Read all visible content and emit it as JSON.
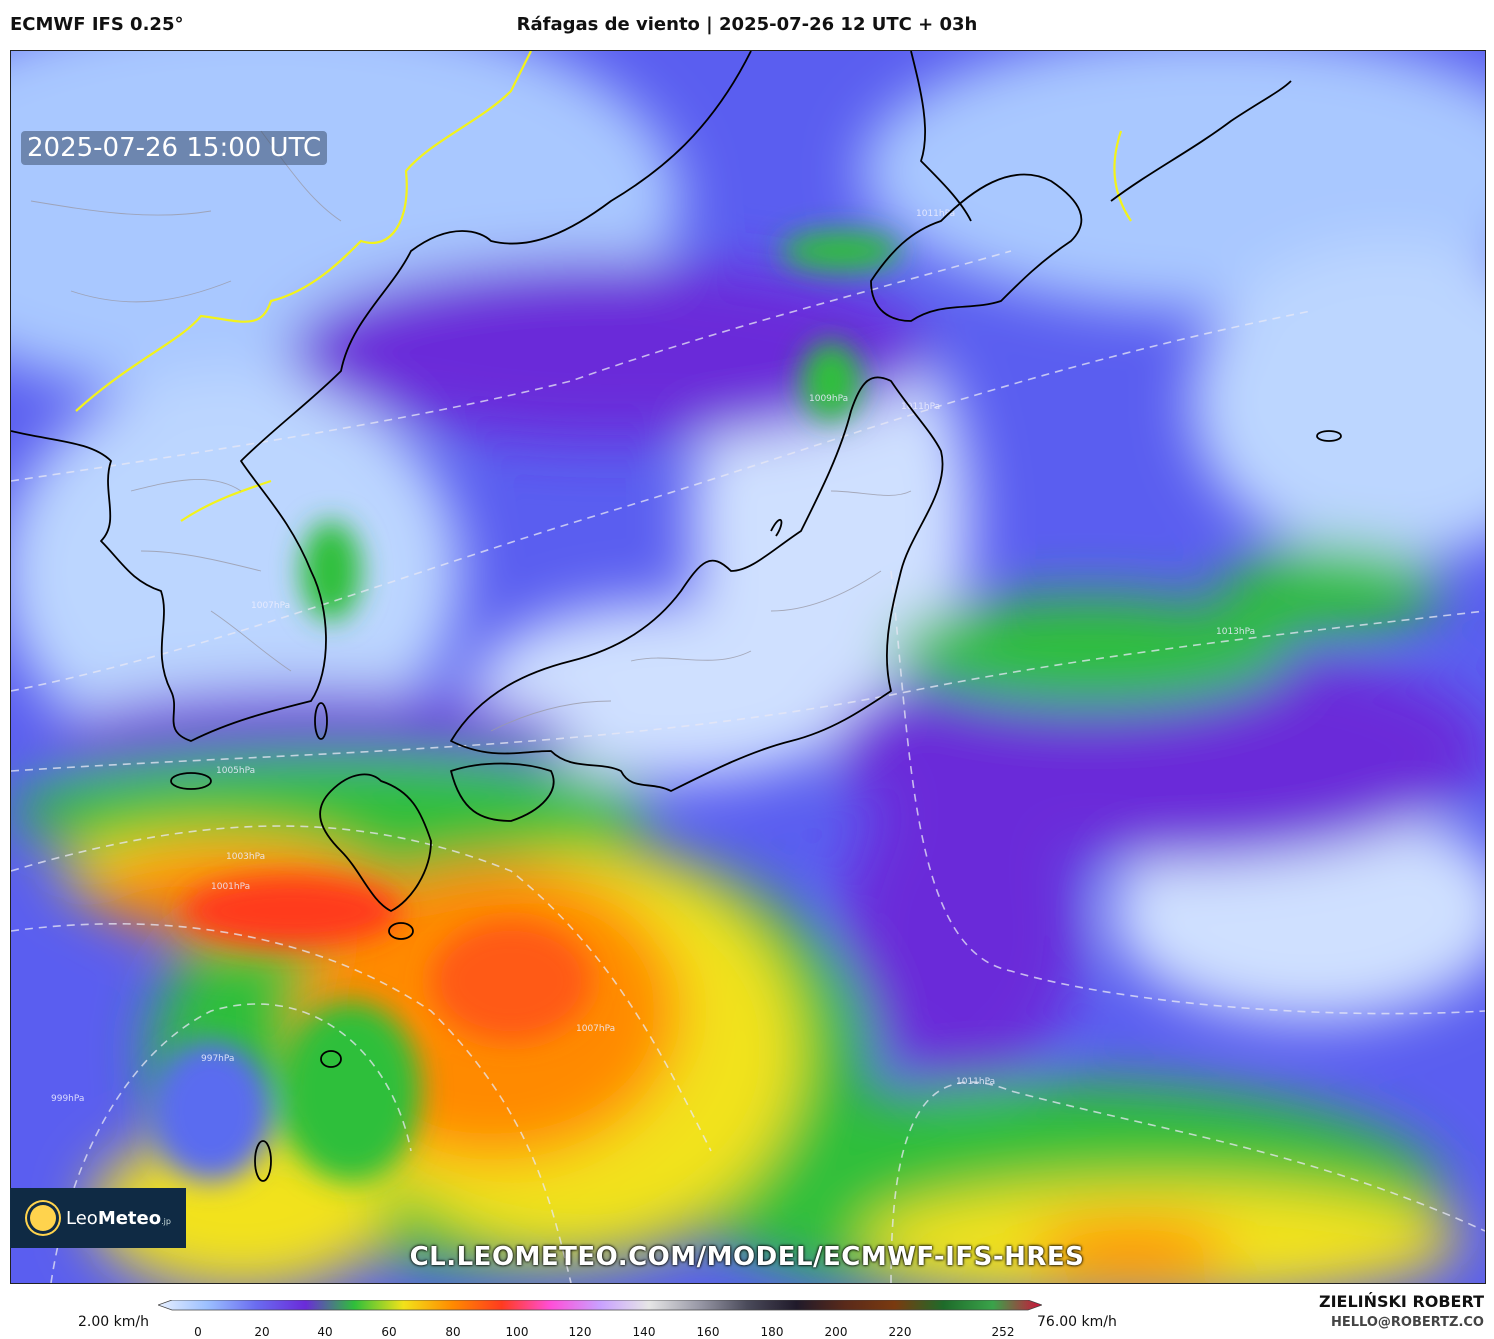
{
  "header": {
    "model": "ECMWF IFS 0.25°",
    "title": "Ráfagas de viento | 2025-07-26 12 UTC + 03h"
  },
  "map": {
    "valid_time": "2025-07-26 15:00 UTC",
    "isobar_labels": [
      "1013hPa",
      "1011hPa",
      "1011hPa",
      "1009hPa",
      "1007hPa",
      "1005hPa",
      "1003hPa",
      "1001hPa",
      "999hPa",
      "997hPa",
      "1007hPa",
      "1011hPa"
    ],
    "colors": {
      "low": "#cfe4ff",
      "light_blue": "#8fb4ff",
      "blue": "#5a6cf0",
      "purple": "#6b2bd9",
      "green": "#2fbf3a",
      "yellow": "#f2e21a",
      "orange": "#ff8a00",
      "red": "#ff3b1f",
      "coast": "#000000",
      "border": "#f3f31a"
    }
  },
  "branding": {
    "logo_text_main": "Leo",
    "logo_text_bold": "Meteo",
    "logo_text_suffix": ".jp",
    "url": "CL.LEOMETEO.COM/MODEL/ECMWF-IFS-HRES"
  },
  "colorbar": {
    "min_label": "2.00 km/h",
    "max_label": "76.00 km/h",
    "ticks": [
      "0",
      "20",
      "40",
      "60",
      "80",
      "100",
      "120",
      "140",
      "160",
      "180",
      "200",
      "220",
      "252"
    ],
    "stops": [
      "#e8f0ff",
      "#9cc0ff",
      "#6a6cf0",
      "#6a2bd9",
      "#2fbf3a",
      "#f2e21a",
      "#ff8a00",
      "#ff3b1f",
      "#ff4fd8",
      "#c9a0ff",
      "#e6e6e6",
      "#9a9aa8",
      "#4a4a5a",
      "#201a2a",
      "#5a2a1a",
      "#7a3a10",
      "#1e6b2a",
      "#3aa34a",
      "#d0103a"
    ]
  },
  "credit": {
    "name": "ZIELIŃSKI ROBERT",
    "email": "HELLO@ROBERTZ.CO"
  }
}
